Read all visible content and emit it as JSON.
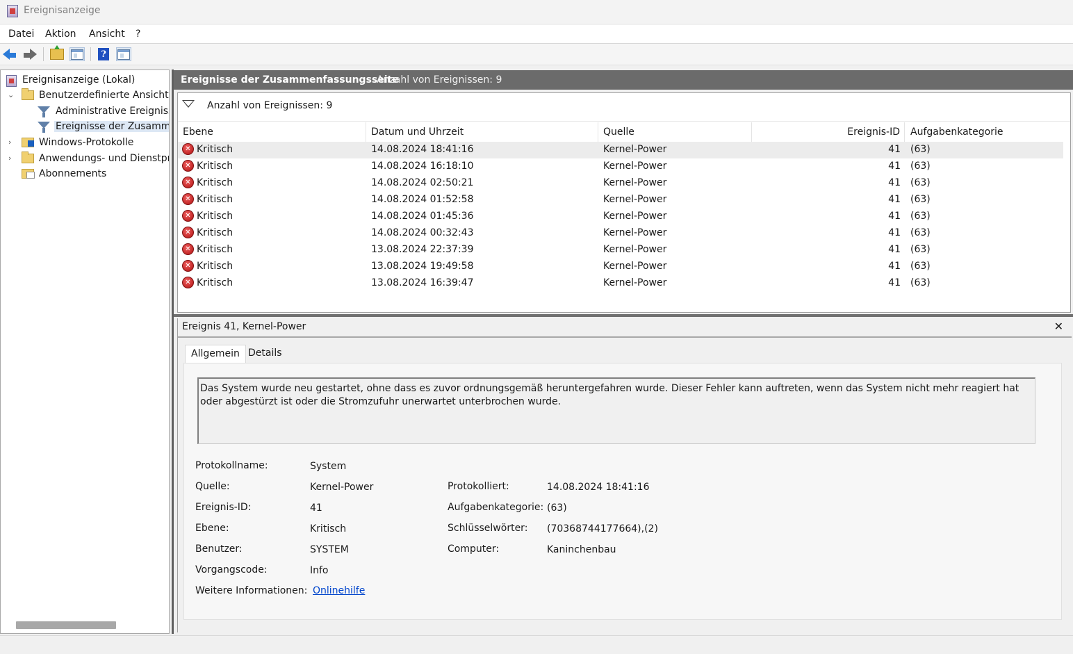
{
  "window": {
    "title": "Ereignisanzeige"
  },
  "menu": [
    "Datei",
    "Aktion",
    "Ansicht",
    "?"
  ],
  "toolbar": {
    "icons": [
      "back-arrow-icon",
      "forward-arrow-icon",
      "folder-up-icon",
      "console-tree-icon",
      "help-icon",
      "action-pane-icon"
    ]
  },
  "tree": {
    "root": "Ereignisanzeige (Lokal)",
    "custom_views": "Benutzerdefinierte Ansichten",
    "admin_events": "Administrative Ereignisse",
    "summary_events": "Ereignisse der Zusammer",
    "windows_logs": "Windows-Protokolle",
    "app_service_logs": "Anwendungs- und Dienstpro",
    "subscriptions": "Abonnements"
  },
  "header": {
    "title": "Ereignisse der Zusammenfassungsseite",
    "count": "Anzahl von Ereignissen: 9"
  },
  "list": {
    "filter_text": "Anzahl von Ereignissen: 9",
    "columns": {
      "level": "Ebene",
      "date": "Datum und Uhrzeit",
      "source": "Quelle",
      "event_id": "Ereignis-ID",
      "category": "Aufgabenkategorie"
    },
    "rows": [
      {
        "level": "Kritisch",
        "date": "14.08.2024 18:41:16",
        "source": "Kernel-Power",
        "event_id": "41",
        "category": "(63)"
      },
      {
        "level": "Kritisch",
        "date": "14.08.2024 16:18:10",
        "source": "Kernel-Power",
        "event_id": "41",
        "category": "(63)"
      },
      {
        "level": "Kritisch",
        "date": "14.08.2024 02:50:21",
        "source": "Kernel-Power",
        "event_id": "41",
        "category": "(63)"
      },
      {
        "level": "Kritisch",
        "date": "14.08.2024 01:52:58",
        "source": "Kernel-Power",
        "event_id": "41",
        "category": "(63)"
      },
      {
        "level": "Kritisch",
        "date": "14.08.2024 01:45:36",
        "source": "Kernel-Power",
        "event_id": "41",
        "category": "(63)"
      },
      {
        "level": "Kritisch",
        "date": "14.08.2024 00:32:43",
        "source": "Kernel-Power",
        "event_id": "41",
        "category": "(63)"
      },
      {
        "level": "Kritisch",
        "date": "13.08.2024 22:37:39",
        "source": "Kernel-Power",
        "event_id": "41",
        "category": "(63)"
      },
      {
        "level": "Kritisch",
        "date": "13.08.2024 19:49:58",
        "source": "Kernel-Power",
        "event_id": "41",
        "category": "(63)"
      },
      {
        "level": "Kritisch",
        "date": "13.08.2024 16:39:47",
        "source": "Kernel-Power",
        "event_id": "41",
        "category": "(63)"
      }
    ]
  },
  "detail": {
    "title": "Ereignis 41, Kernel-Power",
    "close": "✕",
    "tabs": {
      "general": "Allgemein",
      "details": "Details"
    },
    "description": "Das System wurde neu gestartet, ohne dass es zuvor ordnungsgemäß heruntergefahren wurde. Dieser Fehler kann auftreten, wenn das System nicht mehr reagiert hat oder abgestürzt ist oder die Stromzufuhr unerwartet unterbrochen wurde.",
    "labels": {
      "log_name": "Protokollname:",
      "source": "Quelle:",
      "event_id": "Ereignis-ID:",
      "level": "Ebene:",
      "user": "Benutzer:",
      "opcode": "Vorgangscode:",
      "more_info": "Weitere Informationen:",
      "logged": "Protokolliert:",
      "task_category": "Aufgabenkategorie:",
      "keywords": "Schlüsselwörter:",
      "computer": "Computer:"
    },
    "values": {
      "log_name": "System",
      "source": "Kernel-Power",
      "event_id": "41",
      "level": "Kritisch",
      "user": "SYSTEM",
      "opcode": "Info",
      "more_info": "Onlinehilfe",
      "logged": "14.08.2024 18:41:16",
      "task_category": "(63)",
      "keywords": "(70368744177664),(2)",
      "computer": "Kaninchenbau"
    }
  },
  "colors": {
    "header_bg": "#6b6b6b",
    "link": "#0044cc",
    "critical": "#c01818",
    "selection": "#dde8f5"
  }
}
